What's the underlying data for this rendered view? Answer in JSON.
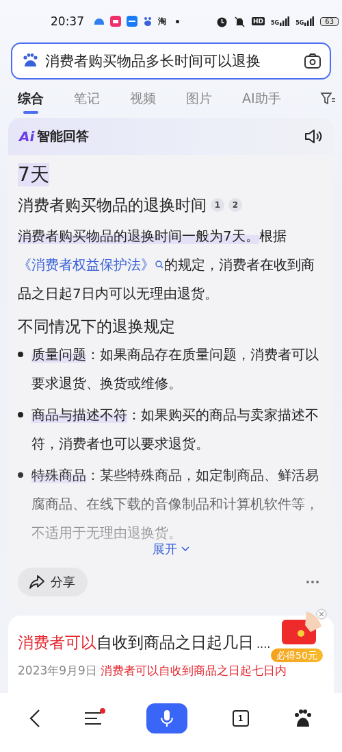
{
  "status_bar": {
    "time": "20:37",
    "app_glyph": "淘",
    "hd": "HD",
    "networks": [
      "5G",
      "5G"
    ],
    "battery": "63"
  },
  "search": {
    "value": "消费者购买物品多长时间可以退换"
  },
  "tabs": [
    {
      "label": "综合",
      "selected": true
    },
    {
      "label": "笔记",
      "selected": false
    },
    {
      "label": "视频",
      "selected": false
    },
    {
      "label": "图片",
      "selected": false
    },
    {
      "label": "AI助手",
      "selected": false
    }
  ],
  "ai_answer": {
    "logo": "Ai",
    "title": "智能回答",
    "headline": "7天",
    "heading": "消费者购买物品的退换时间",
    "citations": [
      "1",
      "2"
    ],
    "paragraph": [
      {
        "kind": "highlight",
        "text": "消费者购买物品的退换时间一般为7天。"
      },
      {
        "kind": "plain",
        "text": "根据"
      },
      {
        "kind": "link",
        "text": "《消费者权益保护法》"
      },
      {
        "kind": "plain",
        "text": "的规定，消费者在收到商品之日起7日内可以无理由退货。"
      }
    ],
    "subheading": "不同情况下的退换规定",
    "bullets": [
      {
        "term": "质量问题",
        "text": "：如果商品存在质量问题，消费者可以要求退货、换货或维修。"
      },
      {
        "term": "商品与描述不符",
        "text": "：如果购买的商品与卖家描述不符，消费者也可以要求退货。"
      },
      {
        "term": "特殊商品",
        "text": "：某些特殊商品，如定制商品、鲜活易腐商品、在线下载的音像制品和计算机软件等，不适用于无理由退换货。"
      }
    ],
    "expand": "展开",
    "share": "分享"
  },
  "result": {
    "title_highlight": "消费者可以",
    "title_rest": "自收到商品之日起几日",
    "title_tail": "....",
    "date": "2023年9月9日",
    "snippet": "消费者可以自收到商品之日起七日内"
  },
  "promo": {
    "label": "必得50元"
  },
  "bottom_nav": {
    "tab_count": "1",
    "menu_badge": true
  }
}
